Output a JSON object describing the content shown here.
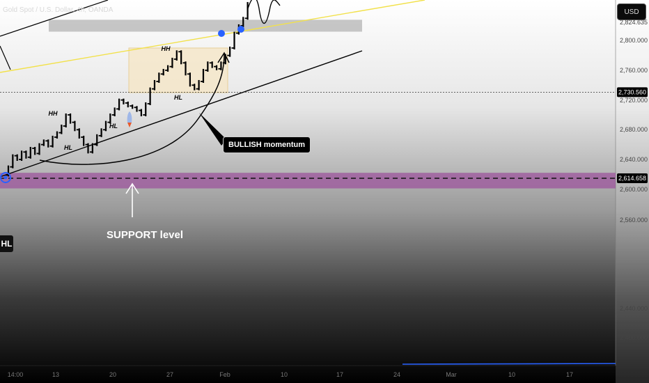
{
  "symbol_title": "Gold Spot / U.S. Dollar, 4h, OANDA",
  "currency": "USD",
  "colors": {
    "background_top": "#ffffff",
    "background_bottom": "#000000",
    "support_zone": "#9b4f9b",
    "yellow_line": "#f2e14a",
    "consolidation_box": "#f5e6c4",
    "marker_blue": "#2962ff",
    "candle": "#000000"
  },
  "chart_data": {
    "type": "line",
    "y_axis_ticks": [
      "2,824.635",
      "2,800.000",
      "2,760.000",
      "2,720.000",
      "2,680.000",
      "2,640.000",
      "2,600.000",
      "2,560.000",
      "2,440.000",
      "2,400.000"
    ],
    "x_axis_ticks": [
      "14:00",
      "13",
      "20",
      "27",
      "Feb",
      "10",
      "17",
      "24",
      "Mar",
      "10",
      "17"
    ],
    "price_labels": [
      "2,730.560",
      "2,614.658"
    ],
    "price_line_values": [
      2730.56,
      2614.658
    ],
    "support_zone": [
      2601,
      2622
    ],
    "resistance_zone": [
      2812,
      2828
    ],
    "consolidation_zone": [
      2730,
      2790
    ],
    "annotations": [
      "BULLISH momentum",
      "SUPPORT level"
    ],
    "swing_labels": [
      {
        "label": "HH",
        "x": 76,
        "y": 166
      },
      {
        "label": "HL",
        "x": 98,
        "y": 215
      },
      {
        "label": "HL",
        "x": 163,
        "y": 184
      },
      {
        "label": "HH",
        "x": 238,
        "y": 73
      },
      {
        "label": "HL",
        "x": 256,
        "y": 143
      }
    ],
    "hl_tag": "HL",
    "series": [
      {
        "values": [
          2619,
          2630,
          2645,
          2640,
          2650,
          2643,
          2655,
          2648,
          2660,
          2665,
          2658,
          2670,
          2676,
          2685,
          2700,
          2690,
          2680,
          2670,
          2660,
          2650,
          2660,
          2672,
          2680,
          2690,
          2700,
          2708,
          2720,
          2716,
          2712,
          2710,
          2706,
          2700,
          2715,
          2735,
          2745,
          2755,
          2760,
          2765,
          2775,
          2785,
          2770,
          2755,
          2740,
          2735,
          2745,
          2760,
          2770,
          2765,
          2762,
          2770,
          2780,
          2790,
          2810,
          2820,
          2830,
          2850
        ]
      }
    ]
  }
}
